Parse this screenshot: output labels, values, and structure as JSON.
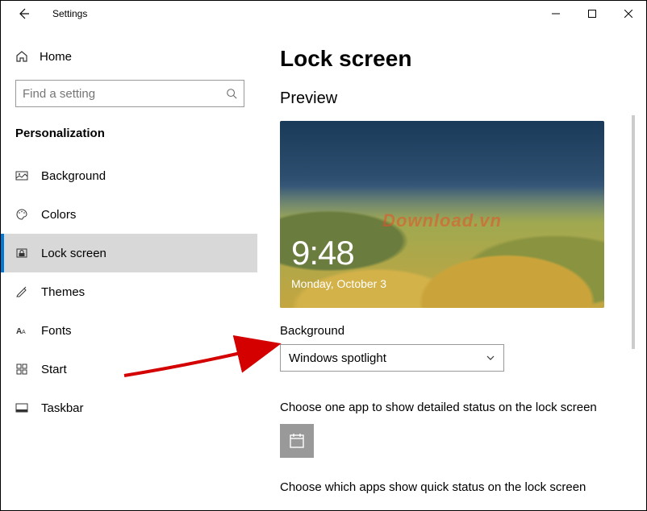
{
  "window": {
    "title": "Settings",
    "controls": {
      "minimize": "minimize",
      "maximize": "maximize",
      "close": "close"
    }
  },
  "sidebar": {
    "home_label": "Home",
    "search_placeholder": "Find a setting",
    "category": "Personalization",
    "items": [
      {
        "icon": "image-icon",
        "label": "Background"
      },
      {
        "icon": "palette-icon",
        "label": "Colors"
      },
      {
        "icon": "lock-screen-icon",
        "label": "Lock screen"
      },
      {
        "icon": "themes-icon",
        "label": "Themes"
      },
      {
        "icon": "fonts-icon",
        "label": "Fonts"
      },
      {
        "icon": "start-icon",
        "label": "Start"
      },
      {
        "icon": "taskbar-icon",
        "label": "Taskbar"
      }
    ]
  },
  "main": {
    "heading": "Lock screen",
    "preview_title": "Preview",
    "clock": "9:48",
    "date": "Monday, October 3",
    "watermark": "Download.vn",
    "background_label": "Background",
    "background_value": "Windows spotlight",
    "detailed_desc": "Choose one app to show detailed status on the lock screen",
    "quick_desc": "Choose which apps show quick status on the lock screen",
    "app_tile_icon": "calendar-icon"
  }
}
